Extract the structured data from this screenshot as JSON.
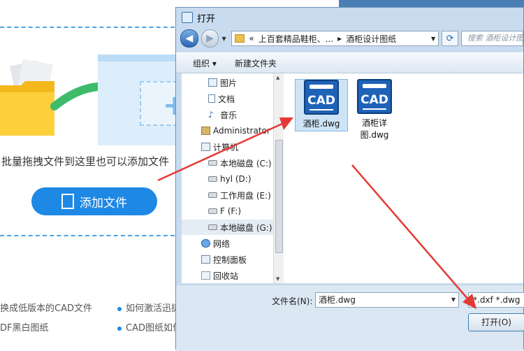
{
  "background": {
    "hint_text": "批量拖拽文件到这里也可以添加文件",
    "add_button_label": "添加文件",
    "links": [
      "换成低版本的CAD文件",
      "如何激活迅捷",
      "DF黑白图纸",
      "CAD图纸如何"
    ]
  },
  "dialog": {
    "title": "打开",
    "breadcrumb": {
      "prefix": "«",
      "parent": "上百套精品鞋柜、...",
      "separator": "▸",
      "current": "酒柜设计图纸"
    },
    "search_placeholder": "搜索 酒柜设计图...",
    "toolbar": {
      "organize": "组织 ▾",
      "new_folder": "新建文件夹"
    },
    "nav_items": [
      {
        "label": "图片",
        "icon": "pictures-icon"
      },
      {
        "label": "文档",
        "icon": "documents-icon"
      },
      {
        "label": "音乐",
        "icon": "music-icon"
      },
      {
        "label": "Administrator",
        "icon": "user-folder-icon"
      },
      {
        "label": "计算机",
        "icon": "computer-icon"
      },
      {
        "label": "本地磁盘 (C:)",
        "icon": "drive-icon"
      },
      {
        "label": "hyl (D:)",
        "icon": "drive-icon"
      },
      {
        "label": "工作用盘 (E:)",
        "icon": "drive-icon"
      },
      {
        "label": "F (F:)",
        "icon": "drive-icon"
      },
      {
        "label": "本地磁盘 (G:)",
        "icon": "drive-icon"
      },
      {
        "label": "网络",
        "icon": "network-icon"
      },
      {
        "label": "控制面板",
        "icon": "control-panel-icon"
      },
      {
        "label": "回收站",
        "icon": "recycle-bin-icon"
      }
    ],
    "files": [
      {
        "icon_text": "CAD",
        "name": "酒柜.dwg"
      },
      {
        "icon_text": "CAD",
        "name": "酒柜详图.dwg"
      }
    ],
    "filename_label": "文件名(N):",
    "filename_value": "酒柜.dwg",
    "filetype_value": "*.dxf *.dwg",
    "open_button_label": "打开(O)"
  },
  "colors": {
    "accent_blue": "#1e88e5",
    "annotation_red": "#e53935",
    "green_arrow": "#3dbb6a"
  }
}
